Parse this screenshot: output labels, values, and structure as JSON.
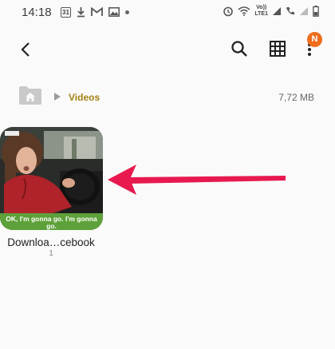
{
  "status_bar": {
    "time": "14:18",
    "calendar_day": "31",
    "volte_label": "Vo))\nLTE1"
  },
  "toolbar": {
    "notification_badge": "N"
  },
  "breadcrumb": {
    "current_folder": "Videos",
    "folder_size": "7,72 MB"
  },
  "files": [
    {
      "name": "Downloa…cebook",
      "count": "1",
      "thumbnail_caption": "OK, I'm gonna go. I'm gonna go."
    }
  ],
  "colors": {
    "accent": "#ef6c1a",
    "breadcrumb_text": "#a58112",
    "annotation_arrow": "#e8194f"
  }
}
